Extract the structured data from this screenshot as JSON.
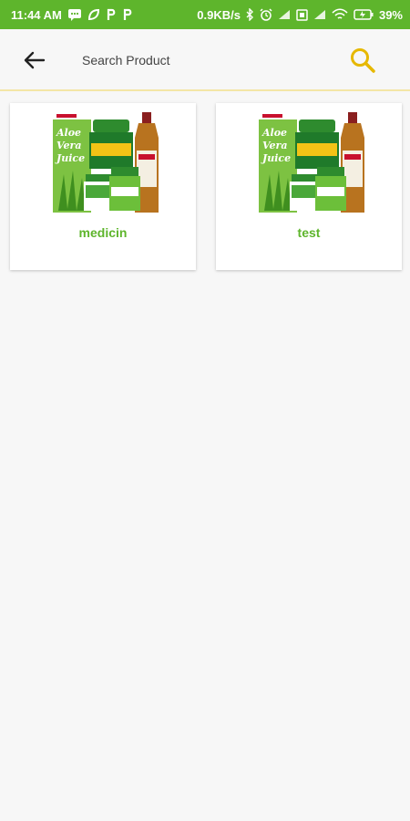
{
  "status_bar": {
    "time": "11:44 AM",
    "speed": "0.9KB/s",
    "battery": "39%",
    "color": "#5eb52c"
  },
  "header": {
    "search_placeholder": "Search Product",
    "search_icon_color": "#e6b800"
  },
  "products": [
    {
      "name": "medicin",
      "image": "aloe-vera-juice-product-photo"
    },
    {
      "name": "test",
      "image": "aloe-vera-juice-product-photo"
    }
  ],
  "accent_color": "#5eb52c"
}
